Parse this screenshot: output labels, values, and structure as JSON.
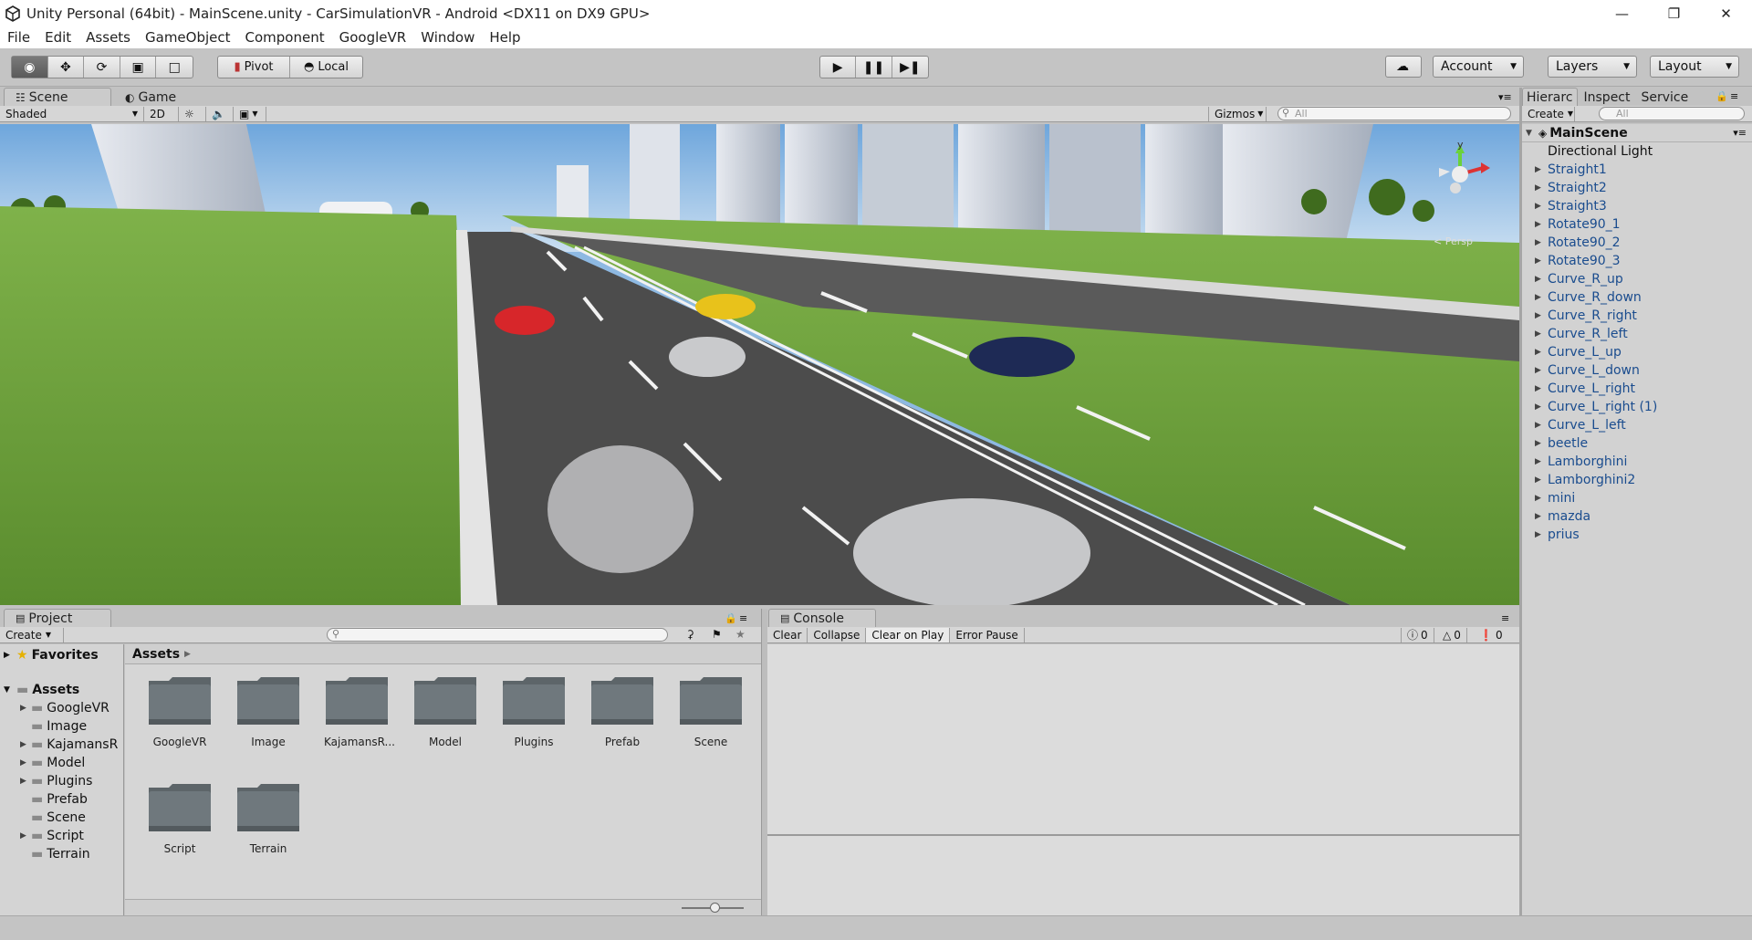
{
  "window": {
    "title": "Unity Personal (64bit) - MainScene.unity - CarSimulationVR - Android <DX11 on DX9 GPU>"
  },
  "menu": [
    "File",
    "Edit",
    "Assets",
    "GameObject",
    "Component",
    "GoogleVR",
    "Window",
    "Help"
  ],
  "toolbar": {
    "pivot": "Pivot",
    "local": "Local",
    "account": "Account",
    "layers": "Layers",
    "layout": "Layout"
  },
  "scene": {
    "tab_scene": "Scene",
    "tab_game": "Game",
    "shading": "Shaded",
    "mode_2d": "2D",
    "gizmos": "Gizmos",
    "search_placeholder": "All",
    "axis_y": "y",
    "persp": "< Persp"
  },
  "hierarchy": {
    "tabs": [
      "Hierarc",
      "Inspect",
      "Service"
    ],
    "create": "Create",
    "search_placeholder": "All",
    "root": "MainScene",
    "items": [
      {
        "label": "Directional Light",
        "expandable": false,
        "color": "#111111"
      },
      {
        "label": "Straight1",
        "expandable": true
      },
      {
        "label": "Straight2",
        "expandable": true
      },
      {
        "label": "Straight3",
        "expandable": true
      },
      {
        "label": "Rotate90_1",
        "expandable": true
      },
      {
        "label": "Rotate90_2",
        "expandable": true
      },
      {
        "label": "Rotate90_3",
        "expandable": true
      },
      {
        "label": "Curve_R_up",
        "expandable": true
      },
      {
        "label": "Curve_R_down",
        "expandable": true
      },
      {
        "label": "Curve_R_right",
        "expandable": true
      },
      {
        "label": "Curve_R_left",
        "expandable": true
      },
      {
        "label": "Curve_L_up",
        "expandable": true
      },
      {
        "label": "Curve_L_down",
        "expandable": true
      },
      {
        "label": "Curve_L_right",
        "expandable": true
      },
      {
        "label": "Curve_L_right (1)",
        "expandable": true
      },
      {
        "label": "Curve_L_left",
        "expandable": true
      },
      {
        "label": "beetle",
        "expandable": true
      },
      {
        "label": "Lamborghini",
        "expandable": true
      },
      {
        "label": "Lamborghini2",
        "expandable": true
      },
      {
        "label": "mini",
        "expandable": true
      },
      {
        "label": "mazda",
        "expandable": true
      },
      {
        "label": "prius",
        "expandable": true
      }
    ]
  },
  "project": {
    "tab": "Project",
    "create": "Create",
    "favorites": "Favorites",
    "assets_root": "Assets",
    "tree": [
      {
        "label": "GoogleVR",
        "expandable": true
      },
      {
        "label": "Image",
        "expandable": false
      },
      {
        "label": "KajamansR",
        "expandable": true
      },
      {
        "label": "Model",
        "expandable": true
      },
      {
        "label": "Plugins",
        "expandable": true
      },
      {
        "label": "Prefab",
        "expandable": false
      },
      {
        "label": "Scene",
        "expandable": false
      },
      {
        "label": "Script",
        "expandable": true
      },
      {
        "label": "Terrain",
        "expandable": false
      }
    ],
    "breadcrumb": "Assets",
    "folders": [
      "GoogleVR",
      "Image",
      "KajamansR...",
      "Model",
      "Plugins",
      "Prefab",
      "Scene",
      "Script",
      "Terrain"
    ]
  },
  "console": {
    "tab": "Console",
    "buttons": [
      "Clear",
      "Collapse",
      "Clear on Play",
      "Error Pause"
    ],
    "info_count": "0",
    "warn_count": "0",
    "error_count": "0"
  },
  "colors": {
    "accent_link": "#1a4c8e",
    "sky": "#8eb9e2",
    "grass": "#6ea03c",
    "road": "#4a4a4a"
  }
}
